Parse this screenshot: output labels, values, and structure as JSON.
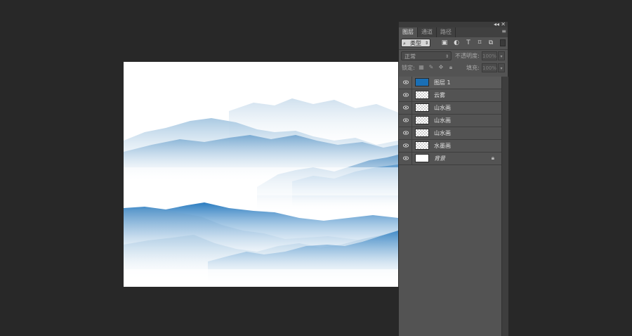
{
  "panel": {
    "tabs": [
      {
        "label": "图层",
        "active": true
      },
      {
        "label": "通道",
        "active": false
      },
      {
        "label": "路径",
        "active": false
      }
    ],
    "filter": {
      "label": "类型"
    },
    "blend_mode": "正常",
    "opacity_label": "不透明度:",
    "opacity_value": "100%",
    "lock_label": "锁定:",
    "fill_label": "填充:",
    "fill_value": "100%"
  },
  "layers": [
    {
      "name": "图层 1",
      "thumb_color": "#1a6fb5"
    },
    {
      "name": "云雾"
    },
    {
      "name": "山水画"
    },
    {
      "name": "山水画"
    },
    {
      "name": "山水画"
    },
    {
      "name": "水墨画"
    },
    {
      "name": "背景"
    }
  ],
  "colors": {
    "app_background": "#282828",
    "panel_background": "#535353",
    "mountain_blue": "#1a6fb5"
  },
  "icons": [
    "collapse-icon",
    "close-icon",
    "panel-menu-icon",
    "search-icon",
    "image-filter-icon",
    "adjustment-filter-icon",
    "type-filter-icon",
    "shape-filter-icon",
    "smart-object-filter-icon",
    "eye-icon",
    "lock-icon"
  ]
}
